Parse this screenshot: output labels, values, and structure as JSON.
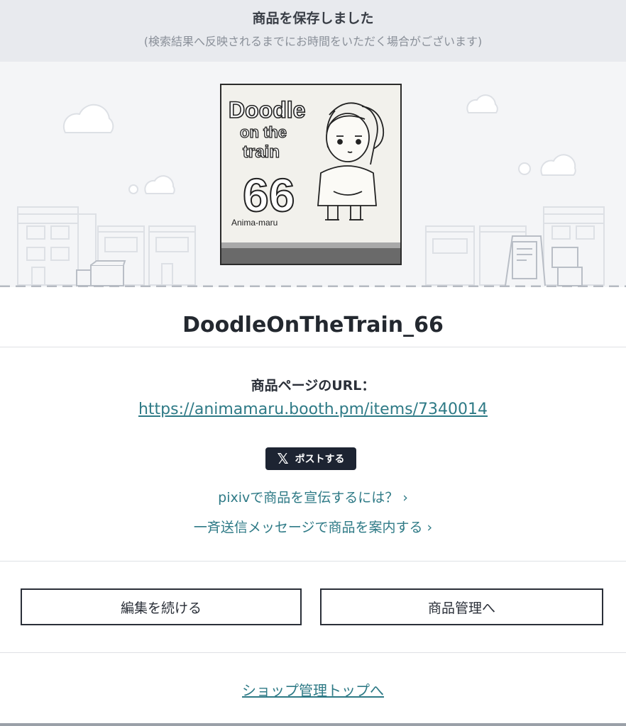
{
  "banner": {
    "title": "商品を保存しました",
    "subtitle": "(検索結果へ反映されるまでにお時間をいただく場合がございます)"
  },
  "product": {
    "thumbnail": {
      "title_line1": "Doodle",
      "title_line2": "on the",
      "title_line3": "train",
      "number": "66",
      "signature": "Anima-maru"
    },
    "name": "DoodleOnTheTrain_66",
    "url_label": "商品ページのURL：",
    "url": "https://animamaru.booth.pm/items/7340014"
  },
  "share": {
    "x_logo": "𝕏",
    "x_label": "ポストする"
  },
  "links": {
    "pixiv_promo": "pixivで商品を宣伝するには？",
    "broadcast": "一斉送信メッセージで商品を案内する",
    "chevron": "›"
  },
  "buttons": {
    "continue_edit": "編集を続ける",
    "to_management": "商品管理へ"
  },
  "footer": {
    "shop_top": "ショップ管理トップへ"
  },
  "colors": {
    "accent_link": "#2e7a86",
    "banner_bg": "#e8eaee",
    "hero_bg": "#f4f5f7",
    "x_button_bg": "#1d2432"
  }
}
